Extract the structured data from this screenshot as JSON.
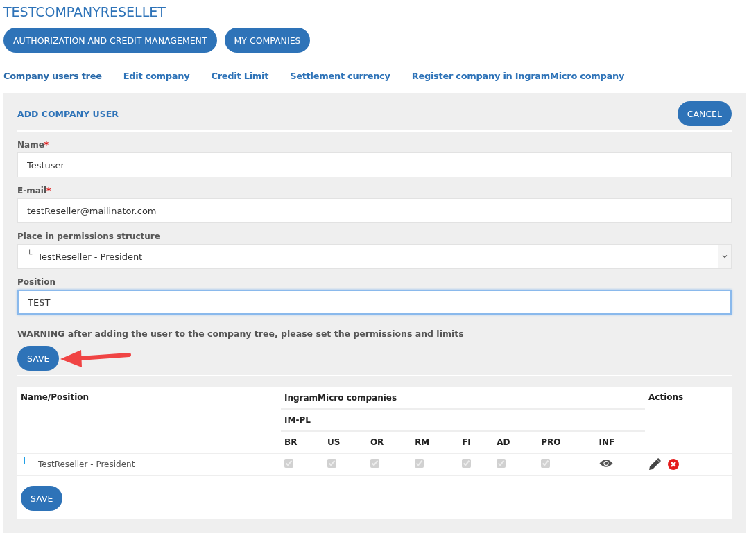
{
  "title": "TESTCOMPANYRESELLET",
  "nav_buttons": [
    "AUTHORIZATION AND CREDIT MANAGEMENT",
    "MY COMPANIES"
  ],
  "tabs": [
    {
      "label": "Company users tree",
      "selected": true
    },
    {
      "label": "Edit company",
      "selected": false
    },
    {
      "label": "Credit Limit",
      "selected": false
    },
    {
      "label": "Settlement currency",
      "selected": false
    },
    {
      "label": "Register company in IngramMicro company",
      "selected": false
    }
  ],
  "panel": {
    "heading": "ADD COMPANY USER",
    "cancel": "CANCEL",
    "fields": [
      {
        "kind": "text",
        "label": "Name",
        "required_mark": "*",
        "value": "Testuser",
        "focused": false
      },
      {
        "kind": "text",
        "label": "E-mail",
        "required_mark": "*",
        "value": "testReseller@mailinator.com",
        "focused": false
      },
      {
        "kind": "select",
        "label": "Place in permissions structure",
        "tree_mark": "└",
        "value": "TestReseller - President",
        "focused": false
      },
      {
        "kind": "text",
        "label": "Position",
        "value": "TEST",
        "focused": true
      }
    ],
    "warning": "WARNING after adding the user to the company tree, please set the permissions and limits",
    "save": "SAVE"
  },
  "table": {
    "name_header": "Name/Position",
    "group_header": "IngramMicro companies",
    "company": "IM-PL",
    "actions_header": "Actions",
    "columns": [
      "BR",
      "US",
      "OR",
      "RM",
      "FI",
      "AD",
      "PRO",
      "INF"
    ],
    "rows": [
      {
        "name": "TestReseller - President",
        "checks": [
          {
            "checked": true,
            "disabled": true
          },
          {
            "checked": true,
            "disabled": true
          },
          {
            "checked": true,
            "disabled": true
          },
          {
            "checked": true,
            "disabled": true
          },
          {
            "checked": true,
            "disabled": true
          },
          {
            "checked": true,
            "disabled": true
          },
          {
            "checked": true,
            "disabled": true
          }
        ]
      }
    ],
    "save": "SAVE"
  }
}
